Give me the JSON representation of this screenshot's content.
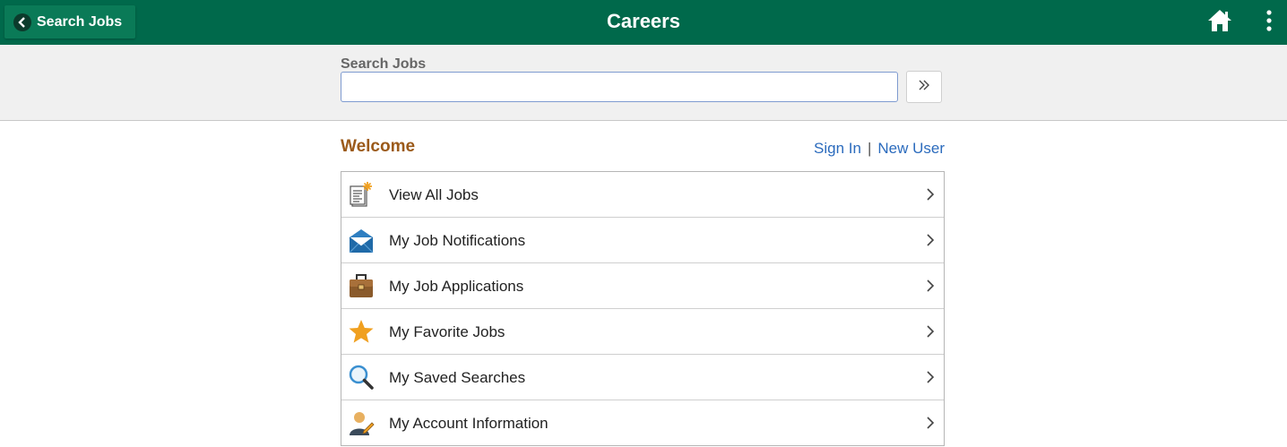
{
  "header": {
    "title": "Careers",
    "back_label": "Search Jobs",
    "background_color": "#00694b"
  },
  "search": {
    "label": "Search Jobs",
    "value": "",
    "placeholder": ""
  },
  "welcome": {
    "heading": "Welcome",
    "sign_in": "Sign In",
    "separator": "|",
    "new_user": "New User"
  },
  "menu": {
    "items": [
      {
        "label": "View All Jobs",
        "icon": "job-list-icon"
      },
      {
        "label": "My Job Notifications",
        "icon": "envelope-icon"
      },
      {
        "label": "My Job Applications",
        "icon": "briefcase-icon"
      },
      {
        "label": "My Favorite Jobs",
        "icon": "star-icon"
      },
      {
        "label": "My Saved Searches",
        "icon": "magnifier-icon"
      },
      {
        "label": "My Account Information",
        "icon": "user-edit-icon"
      }
    ]
  }
}
